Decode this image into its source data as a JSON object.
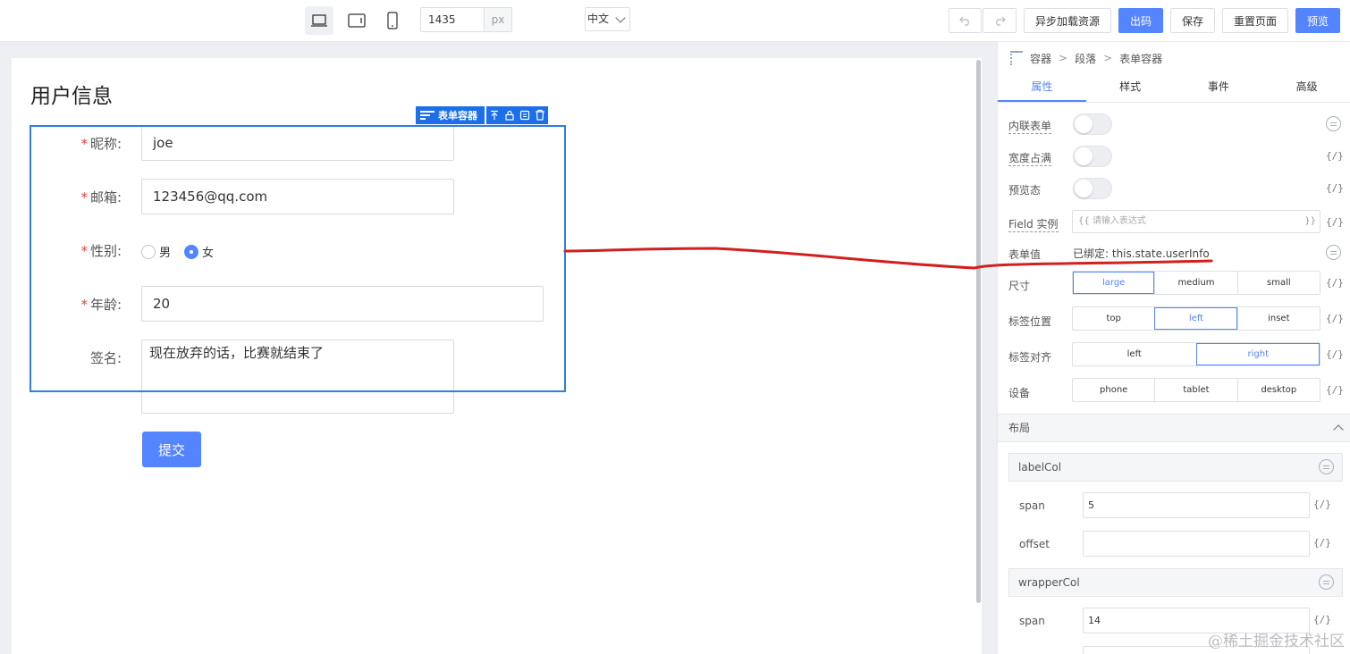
{
  "toolbar": {
    "width_value": "1435",
    "width_unit": "px",
    "language": "中文",
    "async_load_label": "异步加载资源",
    "export_label": "出码",
    "save_label": "保存",
    "reset_label": "重置页面",
    "preview_label": "预览"
  },
  "canvas": {
    "page_title": "用户信息",
    "selection_tag": "表单容器",
    "form": {
      "nickname": {
        "label": "昵称:",
        "value": "joe"
      },
      "email": {
        "label": "邮箱:",
        "value": "123456@qq.com"
      },
      "gender": {
        "label": "性别:",
        "options": [
          "男",
          "女"
        ],
        "selected": "女"
      },
      "age": {
        "label": "年龄:",
        "value": "20"
      },
      "signature": {
        "label": "签名:",
        "value": "现在放弃的话，比赛就结束了"
      },
      "submit_label": "提交"
    }
  },
  "panel": {
    "breadcrumb": [
      "容器",
      "段落",
      "表单容器"
    ],
    "tabs": [
      "属性",
      "样式",
      "事件",
      "高级"
    ],
    "active_tab": "属性",
    "props": {
      "inline_label": "内联表单",
      "full_width_label": "宽度占满",
      "preview_label": "预览态",
      "field_label": "Field 实例",
      "field_placeholder": "请输入表达式",
      "value_label": "表单值",
      "value_bound": "已绑定: this.state.userInfo",
      "size_label": "尺寸",
      "size_options": [
        "large",
        "medium",
        "small"
      ],
      "label_pos_label": "标签位置",
      "label_pos_options": [
        "top",
        "left",
        "inset"
      ],
      "label_align_label": "标签对齐",
      "label_align_options": [
        "left",
        "right"
      ],
      "device_label": "设备",
      "device_options": [
        "phone",
        "tablet",
        "desktop"
      ],
      "var_icon": "{/}"
    },
    "layout": {
      "title": "布局",
      "label_col": {
        "title": "labelCol",
        "span_label": "span",
        "span_value": "5",
        "offset_label": "offset",
        "offset_value": ""
      },
      "wrapper_col": {
        "title": "wrapperCol",
        "span_label": "span",
        "span_value": "14"
      }
    }
  },
  "watermark": "@稀土掘金技术社区",
  "colors": {
    "primary": "#5584ff",
    "selection": "#2f7ee0",
    "annotation": "#d21f1f",
    "required": "#e2453c"
  }
}
